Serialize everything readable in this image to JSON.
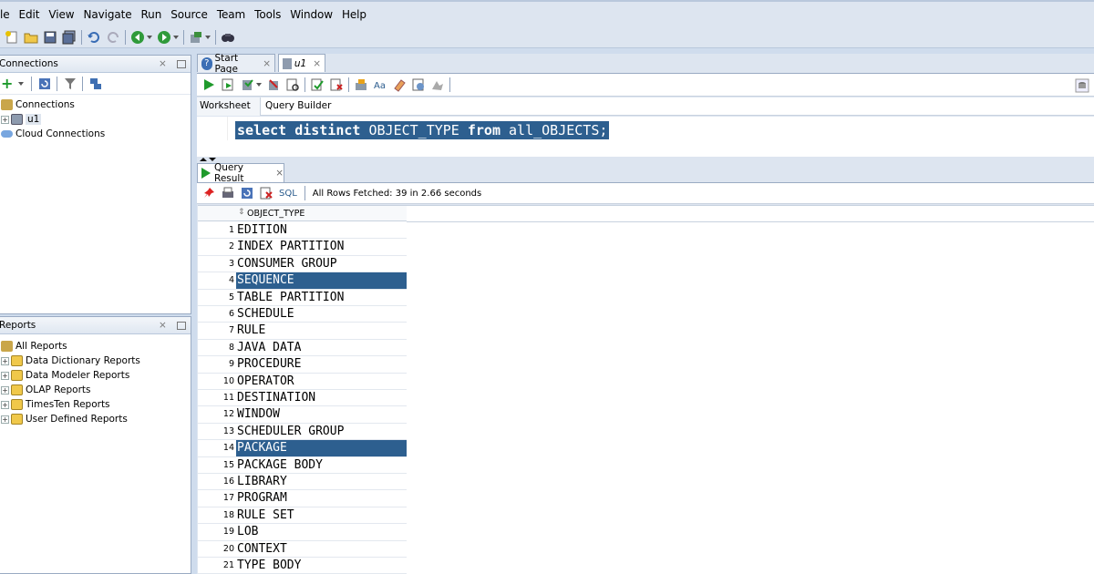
{
  "menu": [
    "le",
    "Edit",
    "View",
    "Navigate",
    "Run",
    "Source",
    "Team",
    "Tools",
    "Window",
    "Help"
  ],
  "toolbar_icons": [
    "new-icon",
    "open-icon",
    "save-icon",
    "save-all-icon",
    "undo-icon",
    "redo-icon",
    "back-icon",
    "forward-icon",
    "sql-icon",
    "find-icon"
  ],
  "connections": {
    "title": "Connections",
    "close": "×",
    "tree": [
      {
        "label": "Connections",
        "icon": "database-folder-icon"
      },
      {
        "label": "u1",
        "icon": "connection-icon"
      },
      {
        "label": "Cloud Connections",
        "icon": "cloud-icon"
      }
    ]
  },
  "reports": {
    "title": "Reports",
    "close": "×",
    "tree": [
      {
        "label": "All Reports"
      },
      {
        "label": "Data Dictionary Reports"
      },
      {
        "label": "Data Modeler Reports"
      },
      {
        "label": "OLAP Reports"
      },
      {
        "label": "TimesTen Reports"
      },
      {
        "label": "User Defined Reports"
      }
    ]
  },
  "tabs": [
    {
      "label": "Start Page",
      "close": "×"
    },
    {
      "label": "u1",
      "close": "×"
    }
  ],
  "editor": {
    "subtabs": [
      "Worksheet",
      "Query Builder"
    ],
    "sql": {
      "kw1": "select distinct",
      "col": "OBJECT_TYPE",
      "kw2": "from",
      "rest": "all_OBJECTS;"
    }
  },
  "result": {
    "tab_label": "Query Result",
    "close": "×",
    "sql_label": "SQL",
    "status": "All Rows Fetched: 39 in 2.66 seconds",
    "column": "OBJECT_TYPE",
    "rows": [
      "EDITION",
      "INDEX PARTITION",
      "CONSUMER GROUP",
      "SEQUENCE",
      "TABLE PARTITION",
      "SCHEDULE",
      "RULE",
      "JAVA DATA",
      "PROCEDURE",
      "OPERATOR",
      "DESTINATION",
      "WINDOW",
      "SCHEDULER GROUP",
      "PACKAGE",
      "PACKAGE BODY",
      "LIBRARY",
      "PROGRAM",
      "RULE SET",
      "LOB",
      "CONTEXT",
      "TYPE BODY"
    ],
    "selected_rows": [
      4,
      14
    ]
  },
  "colors": {
    "selection": "#2d5f8f",
    "menubar": "#dde5f0",
    "frame": "#cfdced"
  }
}
